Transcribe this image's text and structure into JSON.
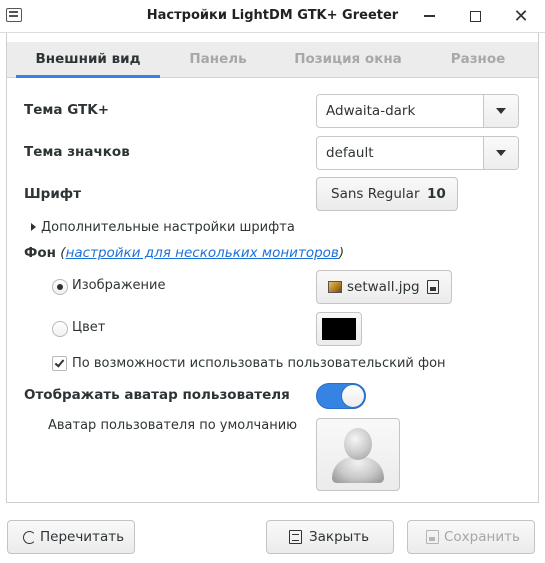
{
  "window": {
    "title": "Настройки LightDM GTK+ Greeter"
  },
  "tabs": [
    {
      "label": "Внешний вид",
      "active": true
    },
    {
      "label": "Панель",
      "active": false
    },
    {
      "label": "Позиция окна",
      "active": false
    },
    {
      "label": "Разное",
      "active": false
    }
  ],
  "appearance": {
    "gtk_theme_label": "Тема GTK+",
    "gtk_theme_value": "Adwaita-dark",
    "icon_theme_label": "Тема значков",
    "icon_theme_value": "default",
    "font_label": "Шрифт",
    "font_name": "Sans Regular",
    "font_size": "10",
    "font_extra_expander": "Дополнительные настройки шрифта",
    "background_label": "Фон",
    "background_paren_open": " (",
    "background_multimonitor_link": "настройки для нескольких мониторов",
    "background_paren_close": ")",
    "image_radio_label": "Изображение",
    "image_file": "setwall.jpg",
    "color_radio_label": "Цвет",
    "background_color": "#000000",
    "user_bg_checkbox_label": "По возможности использовать пользовательский фон",
    "user_bg_checked": true,
    "avatar_switch_label": "Отображать аватар пользователя",
    "avatar_switch_on": true,
    "default_avatar_label": "Аватар пользователя по умолчанию",
    "selected_radio": "image"
  },
  "footer": {
    "reload_label": "Перечитать",
    "close_label": "Закрыть",
    "save_label": "Сохранить",
    "save_enabled": false
  },
  "colors": {
    "accent": "#3584e4",
    "link": "#1c71d8",
    "disabled_text": "#a6a6a6"
  },
  "icons": [
    "app-menu-icon",
    "minimize-icon",
    "maximize-icon",
    "close-icon",
    "image-file-icon",
    "document-open-icon",
    "user-avatar-icon",
    "reload-icon",
    "close-document-icon",
    "save-icon",
    "dropdown-arrow-icon",
    "expander-arrow-icon"
  ]
}
